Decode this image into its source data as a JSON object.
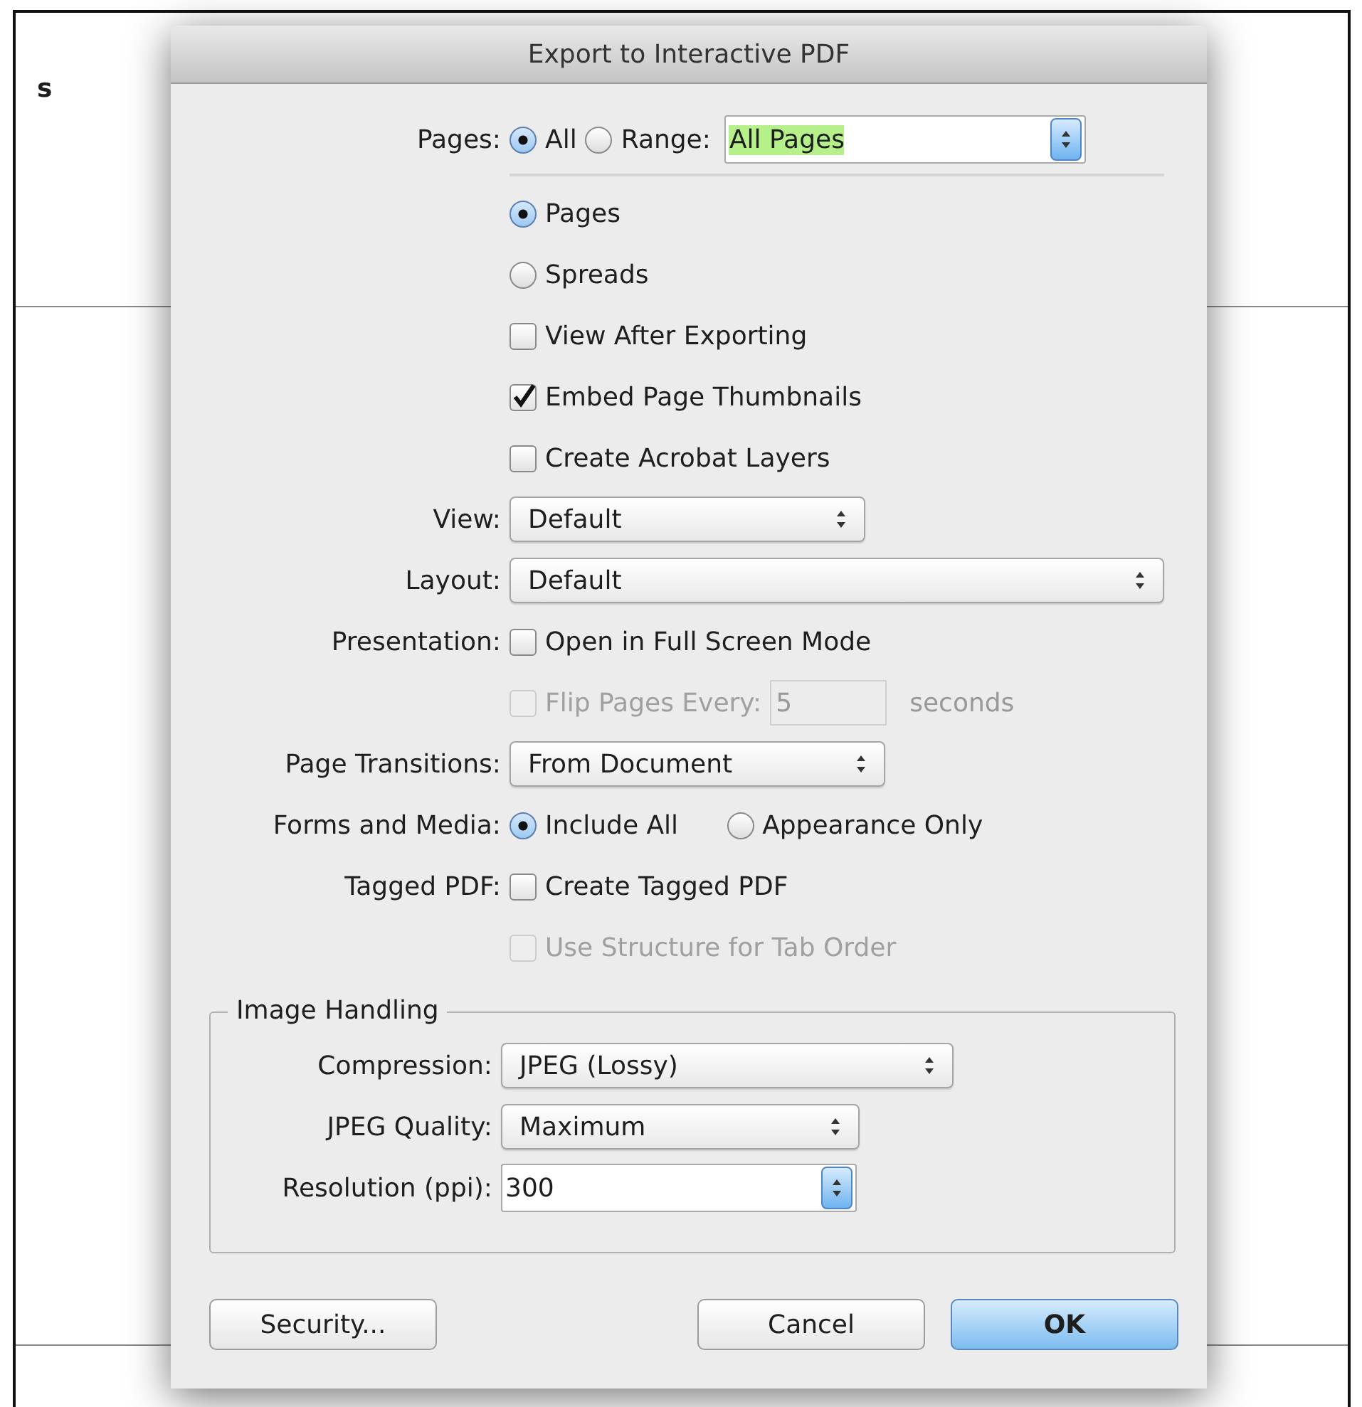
{
  "background": {
    "text": "s"
  },
  "dialog": {
    "title": "Export to Interactive PDF"
  },
  "pages": {
    "label": "Pages:",
    "options": [
      {
        "label": "All",
        "selected": true
      },
      {
        "label": "Range:",
        "selected": false
      }
    ],
    "range_value": "All Pages"
  },
  "page_mode": [
    {
      "label": "Pages",
      "selected": true
    },
    {
      "label": "Spreads",
      "selected": false
    }
  ],
  "options": [
    {
      "label": "View After Exporting",
      "checked": false,
      "disabled": false
    },
    {
      "label": "Embed Page Thumbnails",
      "checked": true,
      "disabled": false
    },
    {
      "label": "Create Acrobat Layers",
      "checked": false,
      "disabled": false
    }
  ],
  "view": {
    "label": "View:",
    "value": "Default"
  },
  "layout": {
    "label": "Layout:",
    "value": "Default"
  },
  "presentation": {
    "label": "Presentation:",
    "full_screen": {
      "label": "Open in Full Screen Mode",
      "checked": false,
      "disabled": false
    },
    "flip": {
      "label": "Flip Pages Every:",
      "checked": false,
      "disabled": true,
      "value": "5",
      "unit": "seconds"
    }
  },
  "page_transitions": {
    "label": "Page Transitions:",
    "value": "From Document"
  },
  "forms_and_media": {
    "label": "Forms and Media:",
    "options": [
      {
        "label": "Include All",
        "selected": true
      },
      {
        "label": "Appearance Only",
        "selected": false
      }
    ]
  },
  "tagged_pdf": {
    "label": "Tagged PDF:",
    "options": [
      {
        "label": "Create Tagged PDF",
        "checked": false,
        "disabled": false
      },
      {
        "label": "Use Structure for Tab Order",
        "checked": false,
        "disabled": true
      }
    ]
  },
  "image_handling": {
    "title": "Image Handling",
    "compression": {
      "label": "Compression:",
      "value": "JPEG (Lossy)"
    },
    "jpeg_quality": {
      "label": "JPEG Quality:",
      "value": "Maximum"
    },
    "resolution": {
      "label": "Resolution (ppi):",
      "value": "300"
    }
  },
  "buttons": [
    {
      "label": "Security...",
      "kind": "plain"
    },
    {
      "label": "Cancel",
      "kind": "plain"
    },
    {
      "label": "OK",
      "kind": "default"
    }
  ]
}
